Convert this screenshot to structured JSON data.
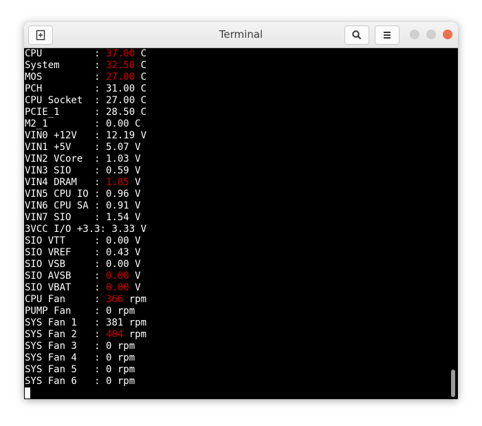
{
  "window": {
    "title": "Terminal"
  },
  "colors": {
    "alert": "#d00000",
    "text": "#ffffff",
    "background": "#000000"
  },
  "rows": [
    {
      "label": "CPU         : ",
      "value": "37.00",
      "unit": " C",
      "alert": true
    },
    {
      "label": "System      : ",
      "value": "32.50",
      "unit": " C",
      "alert": true
    },
    {
      "label": "MOS         : ",
      "value": "27.00",
      "unit": " C",
      "alert": true
    },
    {
      "label": "PCH         : ",
      "value": "31.00",
      "unit": " C",
      "alert": false
    },
    {
      "label": "CPU Socket  : ",
      "value": "27.00",
      "unit": " C",
      "alert": false
    },
    {
      "label": "PCIE_1      : ",
      "value": "28.50",
      "unit": " C",
      "alert": false
    },
    {
      "label": "M2_1        : ",
      "value": "0.00",
      "unit": " C",
      "alert": false
    },
    {
      "label": "VIN0 +12V   : ",
      "value": "12.19",
      "unit": " V",
      "alert": false
    },
    {
      "label": "VIN1 +5V    : ",
      "value": "5.07",
      "unit": " V",
      "alert": false
    },
    {
      "label": "VIN2 VCore  : ",
      "value": "1.03",
      "unit": " V",
      "alert": false
    },
    {
      "label": "VIN3 SIO    : ",
      "value": "0.59",
      "unit": " V",
      "alert": false
    },
    {
      "label": "VIN4 DRAM   : ",
      "value": "1.85",
      "unit": " V",
      "alert": true
    },
    {
      "label": "VIN5 CPU IO : ",
      "value": "0.96",
      "unit": " V",
      "alert": false
    },
    {
      "label": "VIN6 CPU SA : ",
      "value": "0.91",
      "unit": " V",
      "alert": false
    },
    {
      "label": "VIN7 SIO    : ",
      "value": "1.54",
      "unit": " V",
      "alert": false
    },
    {
      "label": "3VCC I/O +3.3: ",
      "value": "3.33",
      "unit": " V",
      "alert": false
    },
    {
      "label": "SIO VTT     : ",
      "value": "0.00",
      "unit": " V",
      "alert": false
    },
    {
      "label": "SIO VREF    : ",
      "value": "0.43",
      "unit": " V",
      "alert": false
    },
    {
      "label": "SIO VSB     : ",
      "value": "0.00",
      "unit": " V",
      "alert": false
    },
    {
      "label": "SIO AVSB    : ",
      "value": "0.00",
      "unit": " V",
      "alert": true
    },
    {
      "label": "SIO VBAT    : ",
      "value": "0.00",
      "unit": " V",
      "alert": true
    },
    {
      "label": "CPU Fan     : ",
      "value": "366",
      "unit": " rpm",
      "alert": true
    },
    {
      "label": "PUMP Fan    : ",
      "value": "0",
      "unit": " rpm",
      "alert": false
    },
    {
      "label": "SYS Fan 1   : ",
      "value": "381",
      "unit": " rpm",
      "alert": false
    },
    {
      "label": "SYS Fan 2   : ",
      "value": "404",
      "unit": " rpm",
      "alert": true
    },
    {
      "label": "SYS Fan 3   : ",
      "value": "0",
      "unit": " rpm",
      "alert": false
    },
    {
      "label": "SYS Fan 4   : ",
      "value": "0",
      "unit": " rpm",
      "alert": false
    },
    {
      "label": "SYS Fan 5   : ",
      "value": "0",
      "unit": " rpm",
      "alert": false
    },
    {
      "label": "SYS Fan 6   : ",
      "value": "0",
      "unit": " rpm",
      "alert": false
    }
  ]
}
